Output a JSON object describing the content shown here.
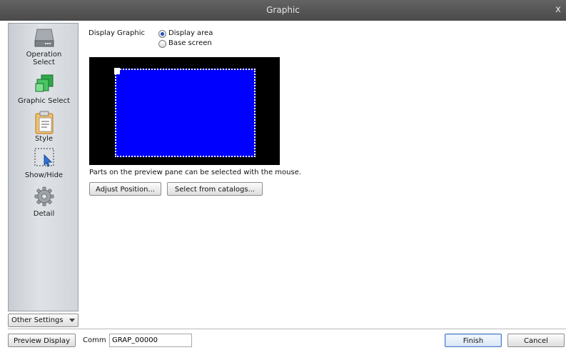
{
  "window": {
    "title": "Graphic"
  },
  "sidebar": {
    "items": [
      {
        "label": "Operation\nSelect",
        "icon": "drive-icon"
      },
      {
        "label": "Graphic Select",
        "icon": "graphic-squares-icon"
      },
      {
        "label": "Style",
        "icon": "clipboard-style-icon",
        "selected": true
      },
      {
        "label": "Show/Hide",
        "icon": "cursor-selection-icon"
      },
      {
        "label": "Detail",
        "icon": "gear-icon"
      }
    ],
    "other_settings": "Other Settings"
  },
  "display_graphic": {
    "label": "Display Graphic",
    "options": [
      {
        "label": "Display area",
        "selected": true
      },
      {
        "label": "Base screen",
        "selected": false
      }
    ]
  },
  "preview": {
    "background_color": "#000000",
    "graphic_color": "#0000ff",
    "hint": "Parts on the preview pane can be selected with the mouse."
  },
  "buttons": {
    "adjust_position": "Adjust Position...",
    "select_from_catalogs": "Select from catalogs...",
    "preview_display": "Preview Display",
    "finish": "Finish",
    "cancel": "Cancel"
  },
  "comment": {
    "label": "Comm",
    "value": "GRAP_00000"
  }
}
